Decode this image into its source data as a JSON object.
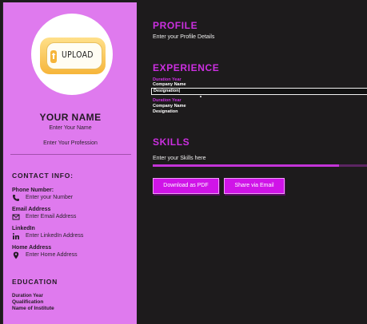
{
  "sidebar": {
    "upload_label": "UPLOAD",
    "name": "YOUR NAME",
    "name_placeholder": "Enter Your Name",
    "profession_placeholder": "Enter Your Profession",
    "contact": {
      "heading": "CONTACT INFO:",
      "items": [
        {
          "label": "Phone Number:",
          "value": "Enter your Number",
          "icon": "phone-icon"
        },
        {
          "label": "Email Address",
          "value": "Enter Email Address",
          "icon": "envelope-icon"
        },
        {
          "label": "LinkedIn",
          "value": "Enter LinkedIn Address",
          "icon": "linkedin-icon"
        },
        {
          "label": "Home Address",
          "value": "Enter Home Address",
          "icon": "map-pin-icon"
        }
      ]
    },
    "education": {
      "heading": "EDUCATION",
      "duration": "Duration Year",
      "qualification": "Qualification",
      "institute": "Name of Institute"
    }
  },
  "main": {
    "profile": {
      "heading": "PROFILE",
      "placeholder": "Enter your Profile Details"
    },
    "experience": {
      "heading": "EXPERIENCE",
      "entries": [
        {
          "duration": "Duration Year",
          "company": "Company Name",
          "designation": "Designation|"
        },
        {
          "duration": "Duration Year",
          "company": "Company Name",
          "designation": "Designation"
        }
      ]
    },
    "skills": {
      "heading": "SKILLS",
      "placeholder": "Enter your Skills here",
      "level": 0.87
    },
    "buttons": {
      "download": "Download as PDF",
      "share": "Share via Email"
    }
  },
  "colors": {
    "sidebar_bg": "#df7aee",
    "main_bg": "#1d1b1c",
    "accent": "#cc2fe1",
    "button_bg": "#d014e8"
  }
}
